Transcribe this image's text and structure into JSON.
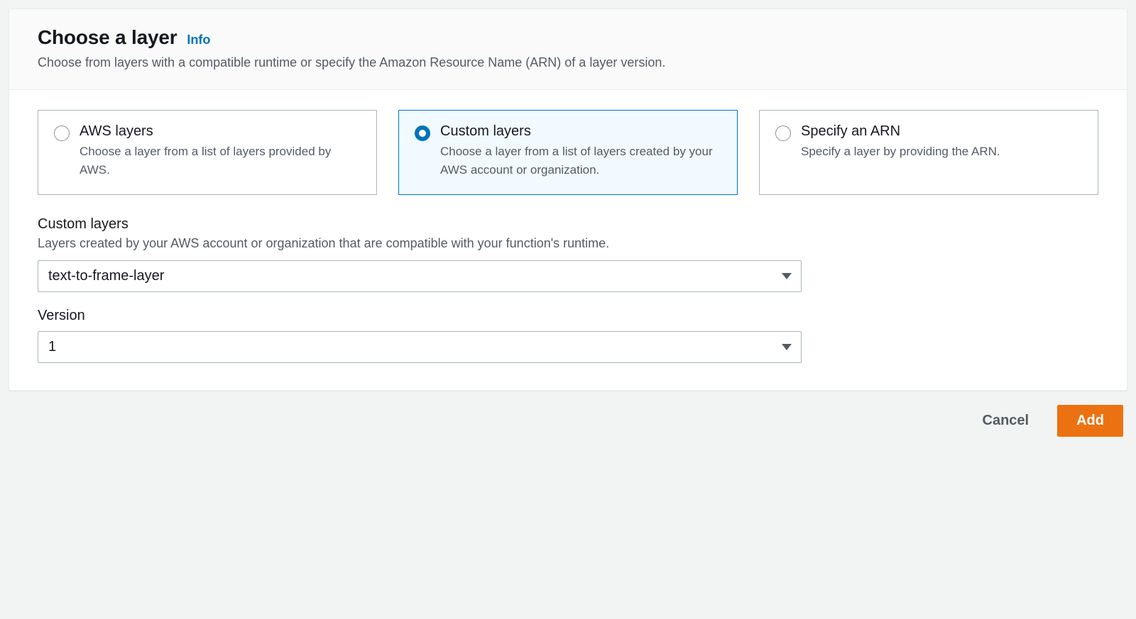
{
  "header": {
    "title": "Choose a layer",
    "info_link": "Info",
    "subtitle": "Choose from layers with a compatible runtime or specify the Amazon Resource Name (ARN) of a layer version."
  },
  "layer_source": {
    "options": [
      {
        "id": "aws",
        "label": "AWS layers",
        "description": "Choose a layer from a list of layers provided by AWS.",
        "selected": false
      },
      {
        "id": "custom",
        "label": "Custom layers",
        "description": "Choose a layer from a list of layers created by your AWS account or organization.",
        "selected": true
      },
      {
        "id": "arn",
        "label": "Specify an ARN",
        "description": "Specify a layer by providing the ARN.",
        "selected": false
      }
    ]
  },
  "custom_layers_field": {
    "label": "Custom layers",
    "hint": "Layers created by your AWS account or organization that are compatible with your function's runtime.",
    "value": "text-to-frame-layer"
  },
  "version_field": {
    "label": "Version",
    "value": "1"
  },
  "actions": {
    "cancel": "Cancel",
    "add": "Add"
  }
}
